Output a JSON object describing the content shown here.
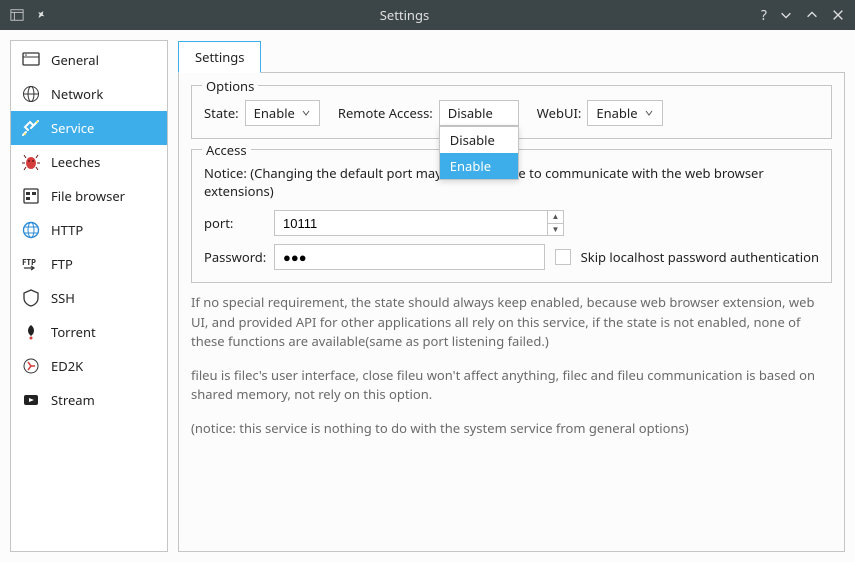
{
  "window": {
    "title": "Settings"
  },
  "sidebar": {
    "items": [
      {
        "label": "General"
      },
      {
        "label": "Network"
      },
      {
        "label": "Service"
      },
      {
        "label": "Leeches"
      },
      {
        "label": "File browser"
      },
      {
        "label": "HTTP"
      },
      {
        "label": "FTP"
      },
      {
        "label": "SSH"
      },
      {
        "label": "Torrent"
      },
      {
        "label": "ED2K"
      },
      {
        "label": "Stream"
      }
    ],
    "active_index": 2
  },
  "tabs": {
    "active": "Settings"
  },
  "options": {
    "group_title": "Options",
    "state_label": "State:",
    "state_value": "Enable",
    "remote_access_label": "Remote Access:",
    "remote_access_value": "Disable",
    "remote_access_options": [
      "Disable",
      "Enable"
    ],
    "remote_access_highlight": "Enable",
    "webui_label": "WebUI:",
    "webui_value": "Enable"
  },
  "access": {
    "group_title": "Access",
    "notice": "Notice: (Changing the default port may cause unable to communicate with the web browser extensions)",
    "port_label": "port:",
    "port_value": "10111",
    "password_label": "Password:",
    "password_value": "●●●",
    "skip_label": "Skip localhost password authentication"
  },
  "info": {
    "p1": "If no special requirement, the state should always keep enabled, because web browser extension, web UI, and provided API for other applications all rely on this service, if the state is not enabled, none of these functions are available(same as port listening failed.)",
    "p2": "fileu is filec's user interface, close fileu won't affect anything, filec and fileu communication is based on shared memory, not rely on this option.",
    "p3": "(notice: this service is nothing to do with the system service from general options)"
  }
}
